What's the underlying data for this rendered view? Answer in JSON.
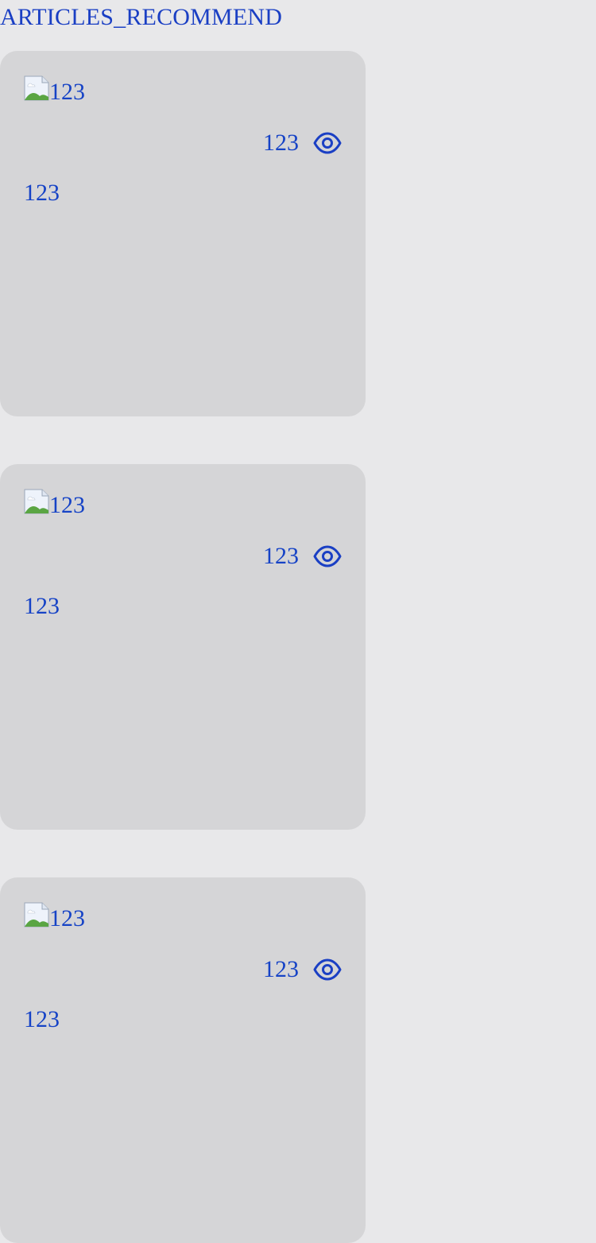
{
  "section": {
    "title": "ARTICLES_RECOMMEND"
  },
  "articles": [
    {
      "image_alt": "123",
      "views": "123",
      "summary": "123"
    },
    {
      "image_alt": "123",
      "views": "123",
      "summary": "123"
    },
    {
      "image_alt": "123",
      "views": "123",
      "summary": "123"
    }
  ],
  "icons": {
    "views": "eye-icon",
    "image": "broken-image-icon"
  },
  "colors": {
    "text": "#1643c6",
    "card_bg": "#d5d5d7",
    "page_bg": "#e8e8ea"
  }
}
